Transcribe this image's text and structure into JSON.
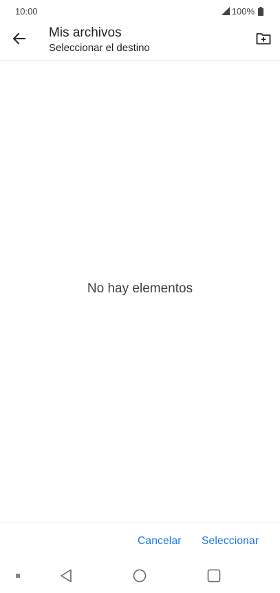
{
  "status_bar": {
    "time": "10:00",
    "battery": "100%",
    "icons": [
      "signal-icon",
      "battery-icon"
    ]
  },
  "app_bar": {
    "title": "Mis archivos",
    "subtitle": "Seleccionar el destino",
    "icons": [
      "arrow-back-icon",
      "create-folder-icon"
    ]
  },
  "main": {
    "empty_message": "No hay elementos"
  },
  "footer": {
    "cancel_label": "Cancelar",
    "select_label": "Seleccionar"
  },
  "nav_bar": {
    "icons": [
      "dot-icon",
      "triangle-back-icon",
      "circle-home-icon",
      "square-recents-icon"
    ]
  },
  "colors": {
    "accent": "#1a73e8",
    "text": "#202124"
  }
}
